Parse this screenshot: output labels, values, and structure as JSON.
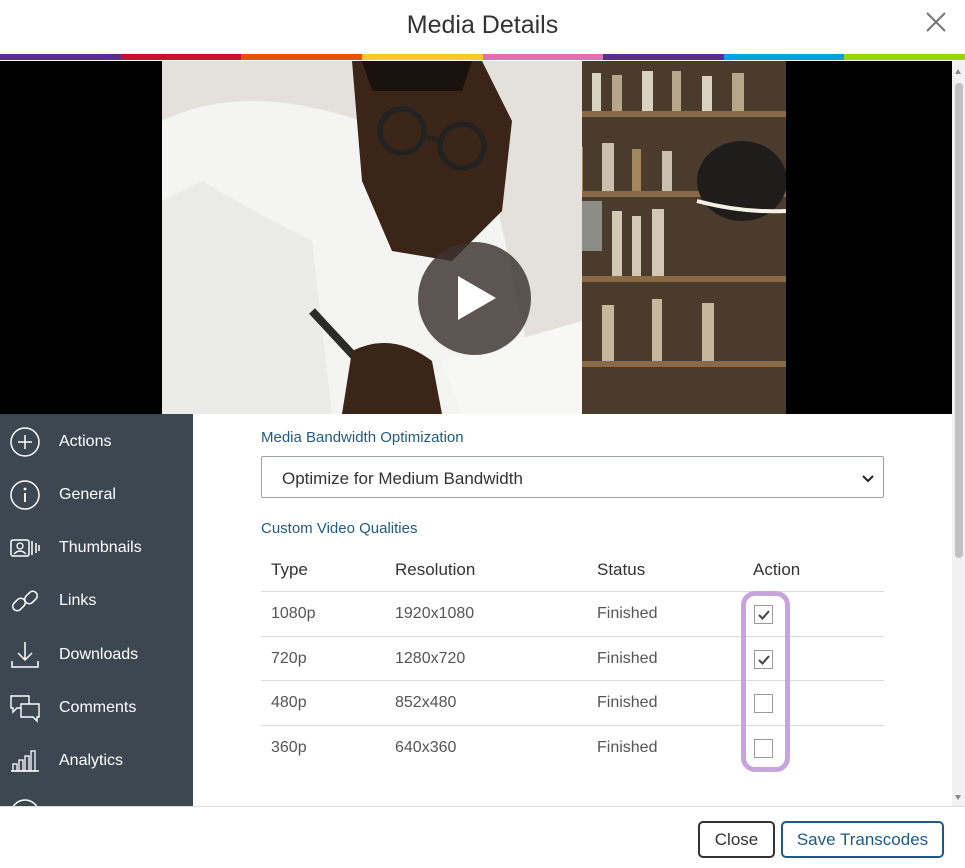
{
  "dialog": {
    "title": "Media Details"
  },
  "stripe_colors": [
    "#5b2d8e",
    "#c8102e",
    "#e35205",
    "#ffc72c",
    "#e56db1",
    "#5b2d8e",
    "#00a3e0",
    "#97d700"
  ],
  "sidebar": {
    "items": [
      {
        "label": "Actions",
        "icon": "plus-circle-icon"
      },
      {
        "label": "General",
        "icon": "info-icon"
      },
      {
        "label": "Thumbnails",
        "icon": "thumbnails-icon"
      },
      {
        "label": "Links",
        "icon": "link-icon"
      },
      {
        "label": "Downloads",
        "icon": "download-icon"
      },
      {
        "label": "Comments",
        "icon": "comments-icon"
      },
      {
        "label": "Analytics",
        "icon": "analytics-icon"
      }
    ]
  },
  "bandwidth": {
    "label": "Media Bandwidth Optimization",
    "selected": "Optimize for Medium Bandwidth"
  },
  "qualities": {
    "label": "Custom Video Qualities",
    "headers": {
      "type": "Type",
      "resolution": "Resolution",
      "status": "Status",
      "action": "Action"
    },
    "rows": [
      {
        "type": "1080p",
        "resolution": "1920x1080",
        "status": "Finished",
        "checked": true
      },
      {
        "type": "720p",
        "resolution": "1280x720",
        "status": "Finished",
        "checked": true
      },
      {
        "type": "480p",
        "resolution": "852x480",
        "status": "Finished",
        "checked": false
      },
      {
        "type": "360p",
        "resolution": "640x360",
        "status": "Finished",
        "checked": false
      }
    ]
  },
  "footer": {
    "close_label": "Close",
    "save_label": "Save Transcodes"
  },
  "colors": {
    "accent": "#1f5a86",
    "sidebar_bg": "#3d4751",
    "highlight": "#c7a4e0"
  }
}
